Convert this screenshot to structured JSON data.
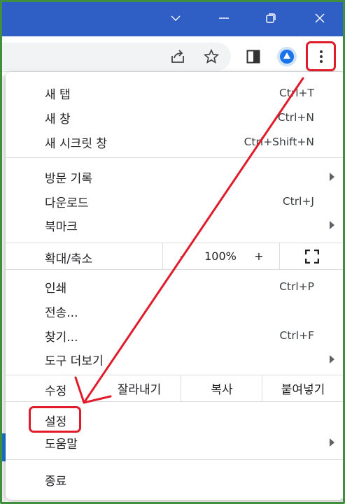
{
  "titlebar": {
    "icons": [
      "chevron-down-icon",
      "minimize-icon",
      "restore-icon",
      "close-icon"
    ]
  },
  "toolbar": {
    "icons": [
      "share-icon",
      "bookmark-star-icon",
      "side-panel-icon",
      "extension-icon",
      "more-menu-icon"
    ]
  },
  "menu": {
    "group1": [
      {
        "label": "새 탭",
        "shortcut": "Ctrl+T"
      },
      {
        "label": "새 창",
        "shortcut": "Ctrl+N"
      },
      {
        "label": "새 시크릿 창",
        "shortcut": "Ctrl+Shift+N"
      }
    ],
    "group2": [
      {
        "label": "방문 기록",
        "shortcut": "",
        "submenu": true
      },
      {
        "label": "다운로드",
        "shortcut": "Ctrl+J",
        "submenu": false
      },
      {
        "label": "북마크",
        "shortcut": "",
        "submenu": true
      }
    ],
    "zoom": {
      "label": "확대/축소",
      "minus": "-",
      "value": "100%",
      "plus": "+"
    },
    "group3": [
      {
        "label": "인쇄",
        "shortcut": "Ctrl+P"
      },
      {
        "label": "전송...",
        "shortcut": ""
      },
      {
        "label": "찾기...",
        "shortcut": "Ctrl+F"
      },
      {
        "label": "도구 더보기",
        "shortcut": "",
        "submenu": true
      }
    ],
    "edit": {
      "label": "수정",
      "cut": "잘라내기",
      "copy": "복사",
      "paste": "붙여넣기"
    },
    "group4": [
      {
        "label": "설정",
        "submenu": false
      },
      {
        "label": "도움말",
        "submenu": true
      }
    ],
    "exit": {
      "label": "종료"
    }
  },
  "colors": {
    "titlebar": "#2f5fc4",
    "frame": "#3f8f3f",
    "annotation": "#e11c2a"
  }
}
